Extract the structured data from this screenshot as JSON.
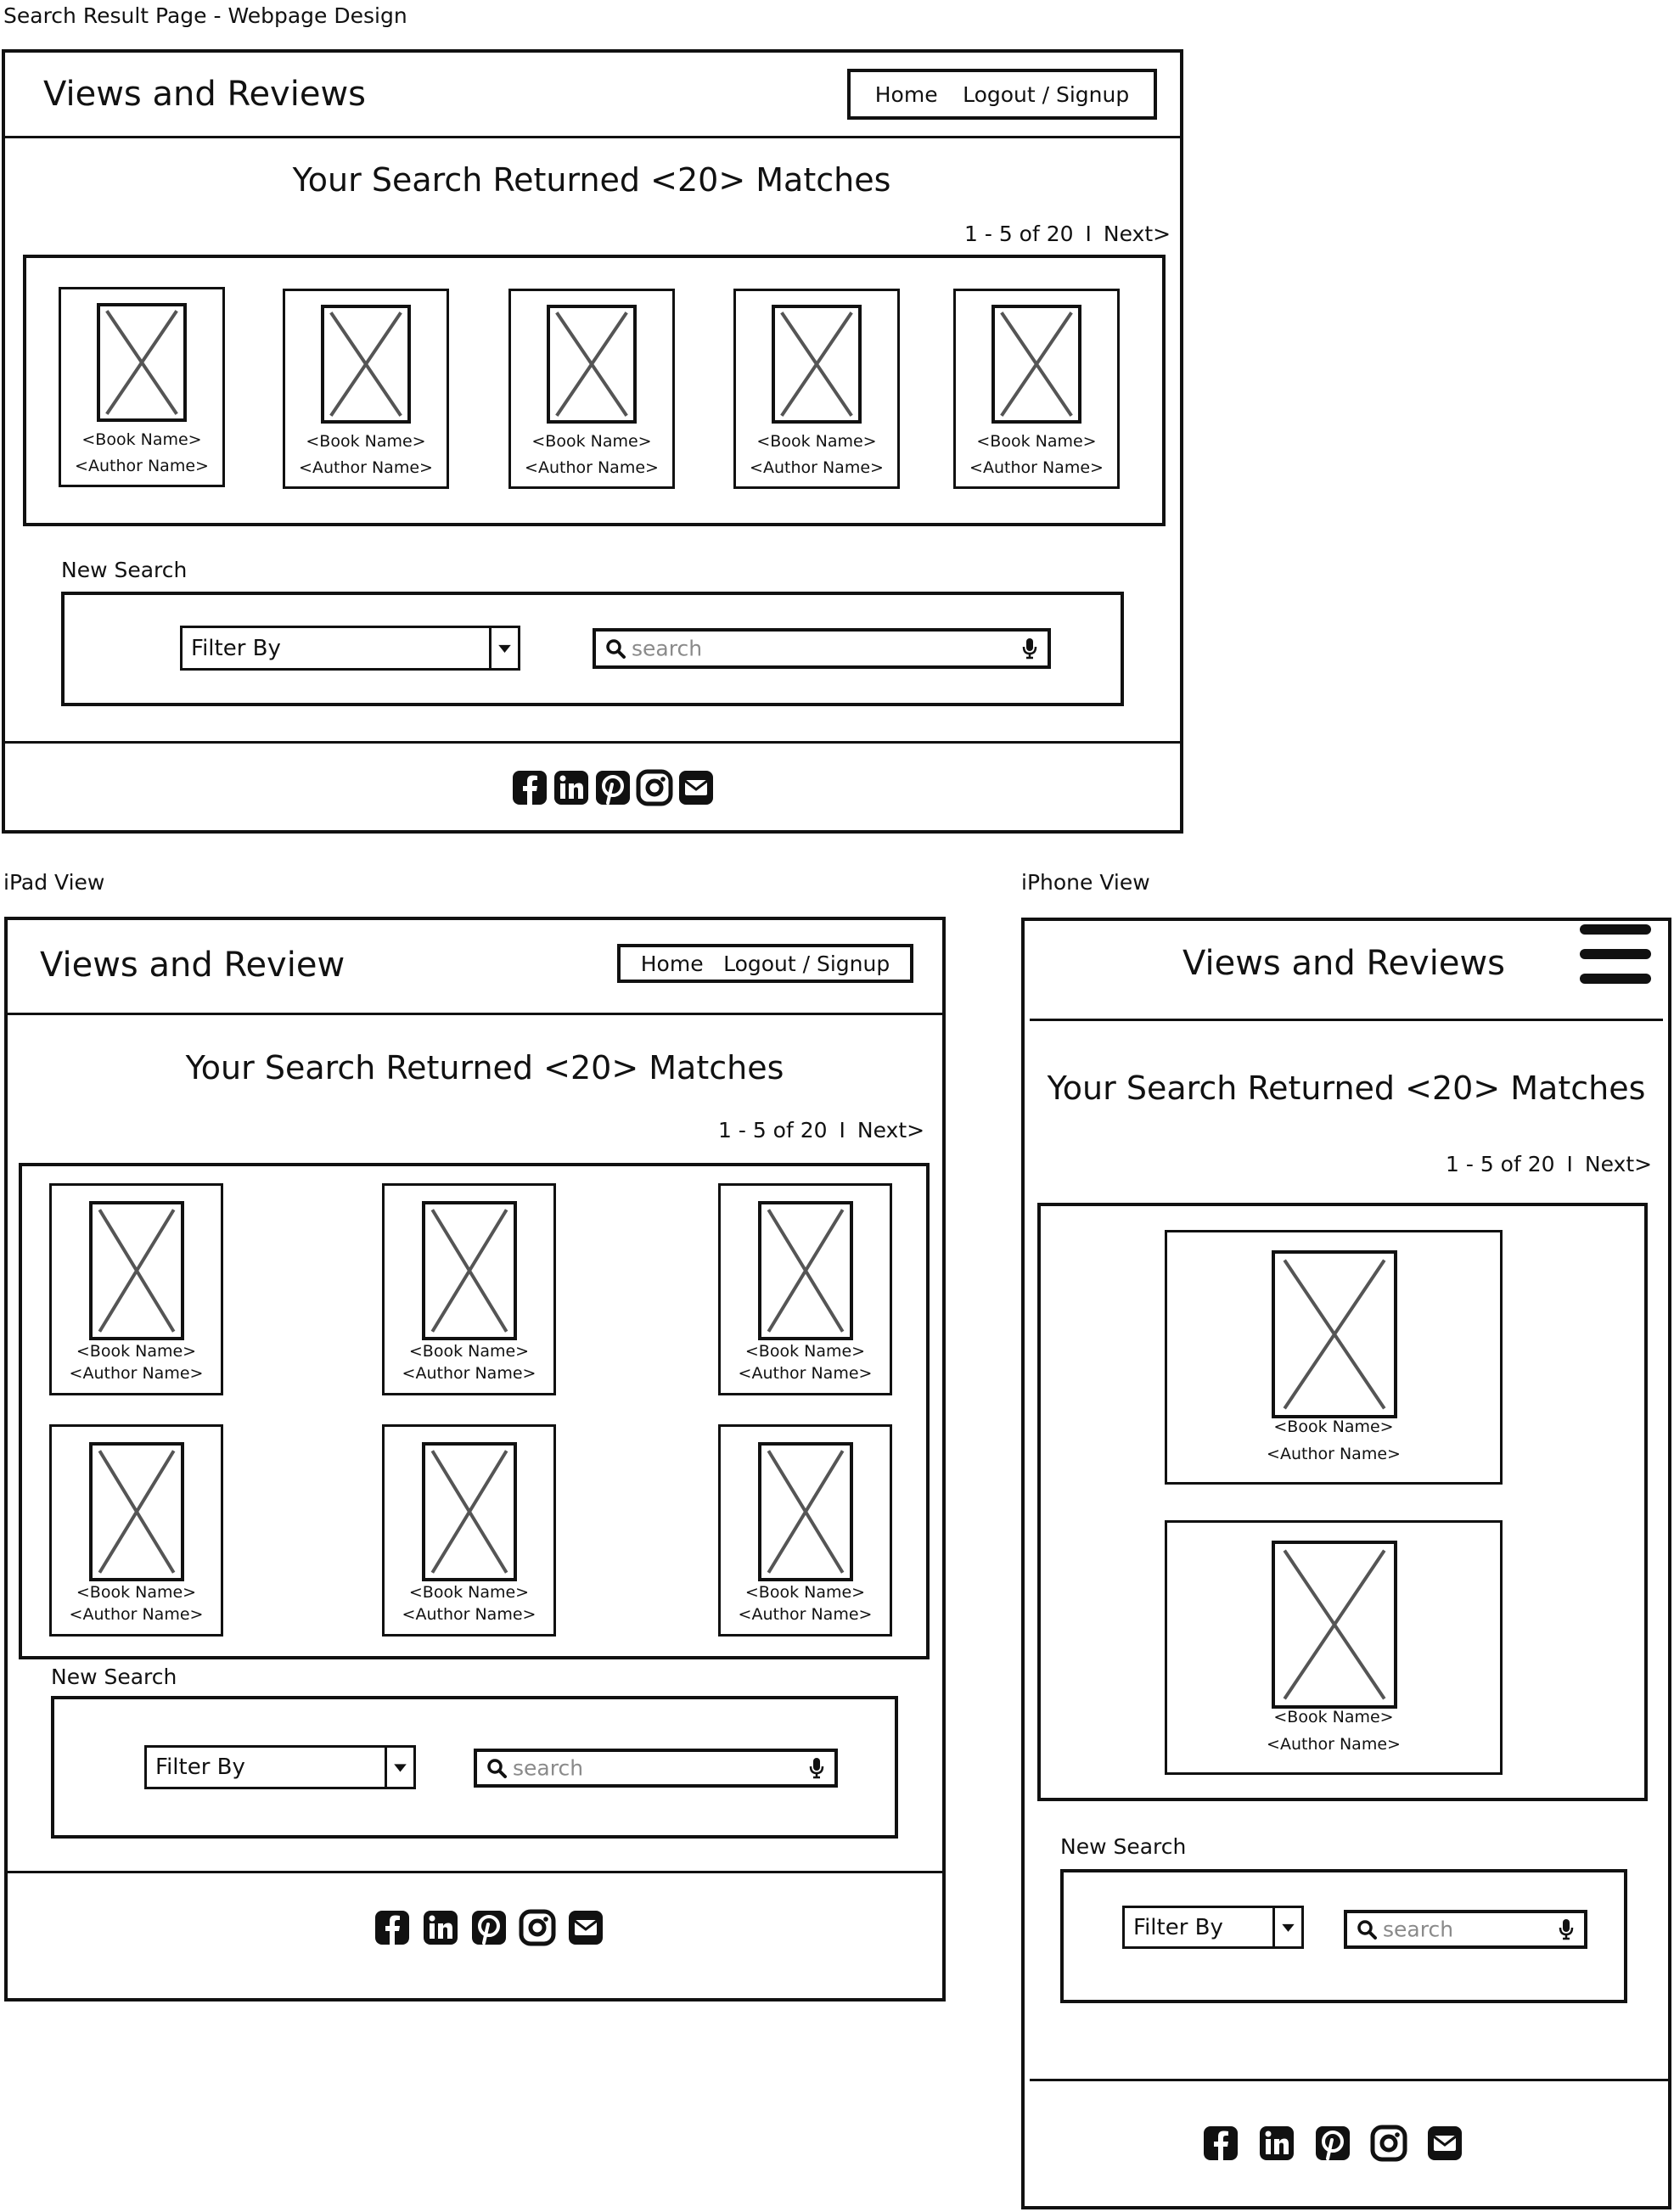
{
  "captions": {
    "desktop": "Search Result Page - Webpage Design",
    "ipad": "iPad View",
    "iphone": "iPhone View"
  },
  "desktop": {
    "site_title": "Views and Reviews",
    "nav": {
      "home": "Home",
      "logout": "Logout / Signup"
    },
    "heading": "Your Search Returned <20> Matches",
    "pager": {
      "range": "1 - 5 of 20",
      "separator": "I",
      "next": "Next>"
    },
    "cards": [
      {
        "book": "<Book Name>",
        "author": "<Author Name>"
      },
      {
        "book": "<Book Name>",
        "author": "<Author Name>"
      },
      {
        "book": "<Book Name>",
        "author": "<Author Name>"
      },
      {
        "book": "<Book Name>",
        "author": "<Author Name>"
      },
      {
        "book": "<Book Name>",
        "author": "<Author Name>"
      }
    ],
    "new_search": "New Search",
    "filter": "Filter By",
    "search_placeholder": "search"
  },
  "ipad": {
    "site_title": "Views and Review",
    "nav": {
      "home": "Home",
      "logout": "Logout / Signup"
    },
    "heading": "Your Search Returned <20> Matches",
    "pager": {
      "range": "1 - 5 of 20",
      "separator": "I",
      "next": "Next>"
    },
    "cards": [
      {
        "book": "<Book Name>",
        "author": "<Author Name>"
      },
      {
        "book": "<Book Name>",
        "author": "<Author Name>"
      },
      {
        "book": "<Book Name>",
        "author": "<Author Name>"
      },
      {
        "book": "<Book Name>",
        "author": "<Author Name>"
      },
      {
        "book": "<Book Name>",
        "author": "<Author Name>"
      },
      {
        "book": "<Book Name>",
        "author": "<Author Name>"
      }
    ],
    "new_search": "New Search",
    "filter": "Filter By",
    "search_placeholder": "search"
  },
  "iphone": {
    "site_title": "Views and Reviews",
    "heading": "Your Search Returned <20> Matches",
    "pager": {
      "range": "1 - 5 of 20",
      "separator": "I",
      "next": "Next>"
    },
    "cards": [
      {
        "book": "<Book Name>",
        "author": "<Author Name>"
      },
      {
        "book": "<Book Name>",
        "author": "<Author Name>"
      }
    ],
    "new_search": "New Search",
    "filter": "Filter By",
    "search_placeholder": "search"
  },
  "social_icons": [
    "facebook-icon",
    "linkedin-icon",
    "pinterest-icon",
    "instagram-icon",
    "email-icon"
  ]
}
